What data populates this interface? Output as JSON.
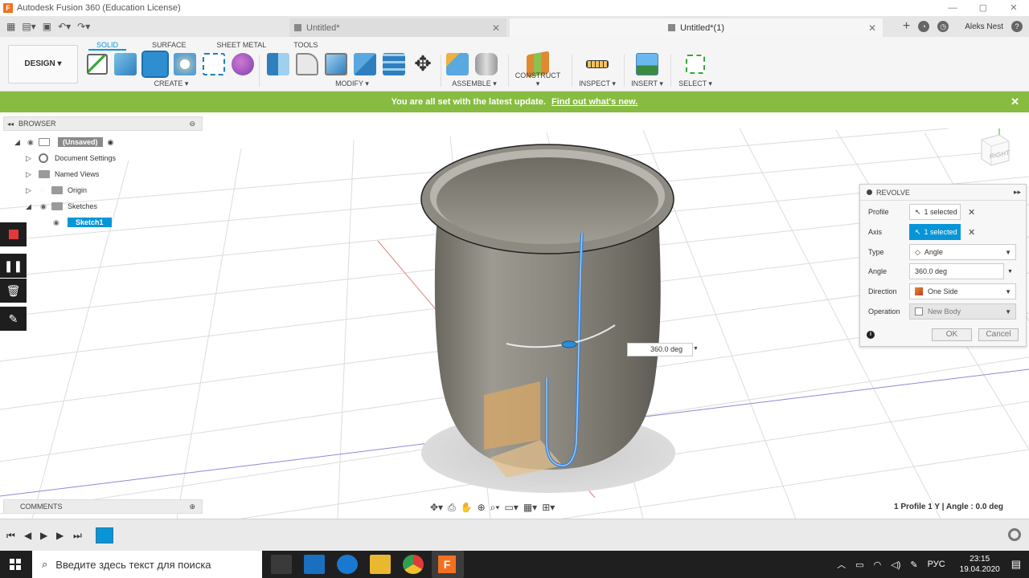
{
  "window": {
    "title": "Autodesk Fusion 360 (Education License)"
  },
  "tabs": [
    {
      "label": "Untitled*"
    },
    {
      "label": "Untitled*(1)"
    }
  ],
  "user": {
    "name": "Aleks Nest"
  },
  "toolbar": {
    "design_label": "DESIGN ▾",
    "workspace_tabs": [
      "SOLID",
      "SURFACE",
      "SHEET METAL",
      "TOOLS"
    ],
    "groups": [
      "CREATE ▾",
      "MODIFY ▾",
      "ASSEMBLE ▾",
      "CONSTRUCT ▾",
      "INSPECT ▾",
      "INSERT ▾",
      "SELECT ▾"
    ]
  },
  "notification": {
    "text": "You are all set with the latest update.",
    "link": "Find out what's new."
  },
  "browser": {
    "title": "BROWSER",
    "items": [
      {
        "label": "(Unsaved)"
      },
      {
        "label": "Document Settings"
      },
      {
        "label": "Named Views"
      },
      {
        "label": "Origin"
      },
      {
        "label": "Sketches"
      },
      {
        "label": "Sketch1"
      }
    ]
  },
  "viewcube": {
    "label": "RIGHT"
  },
  "revolve": {
    "title": "REVOLVE",
    "profile_label": "Profile",
    "profile_value": "1 selected",
    "axis_label": "Axis",
    "axis_value": "1 selected",
    "type_label": "Type",
    "type_value": "Angle",
    "angle_label": "Angle",
    "angle_value": "360.0 deg",
    "direction_label": "Direction",
    "direction_value": "One Side",
    "operation_label": "Operation",
    "operation_value": "New Body",
    "ok_label": "OK",
    "cancel_label": "Cancel"
  },
  "angle_manip": {
    "value": "360.0 deg"
  },
  "comments": {
    "title": "COMMENTS"
  },
  "status": {
    "text": "1 Profile 1 Y | Angle : 0.0 deg"
  },
  "taskbar": {
    "search_placeholder": "Введите здесь текст для поиска",
    "lang": "РУС",
    "time": "23:15",
    "date": "19.04.2020"
  },
  "colors": {
    "accent": "#0696d7",
    "notification": "#87bc40",
    "model": "#7c7a72"
  }
}
